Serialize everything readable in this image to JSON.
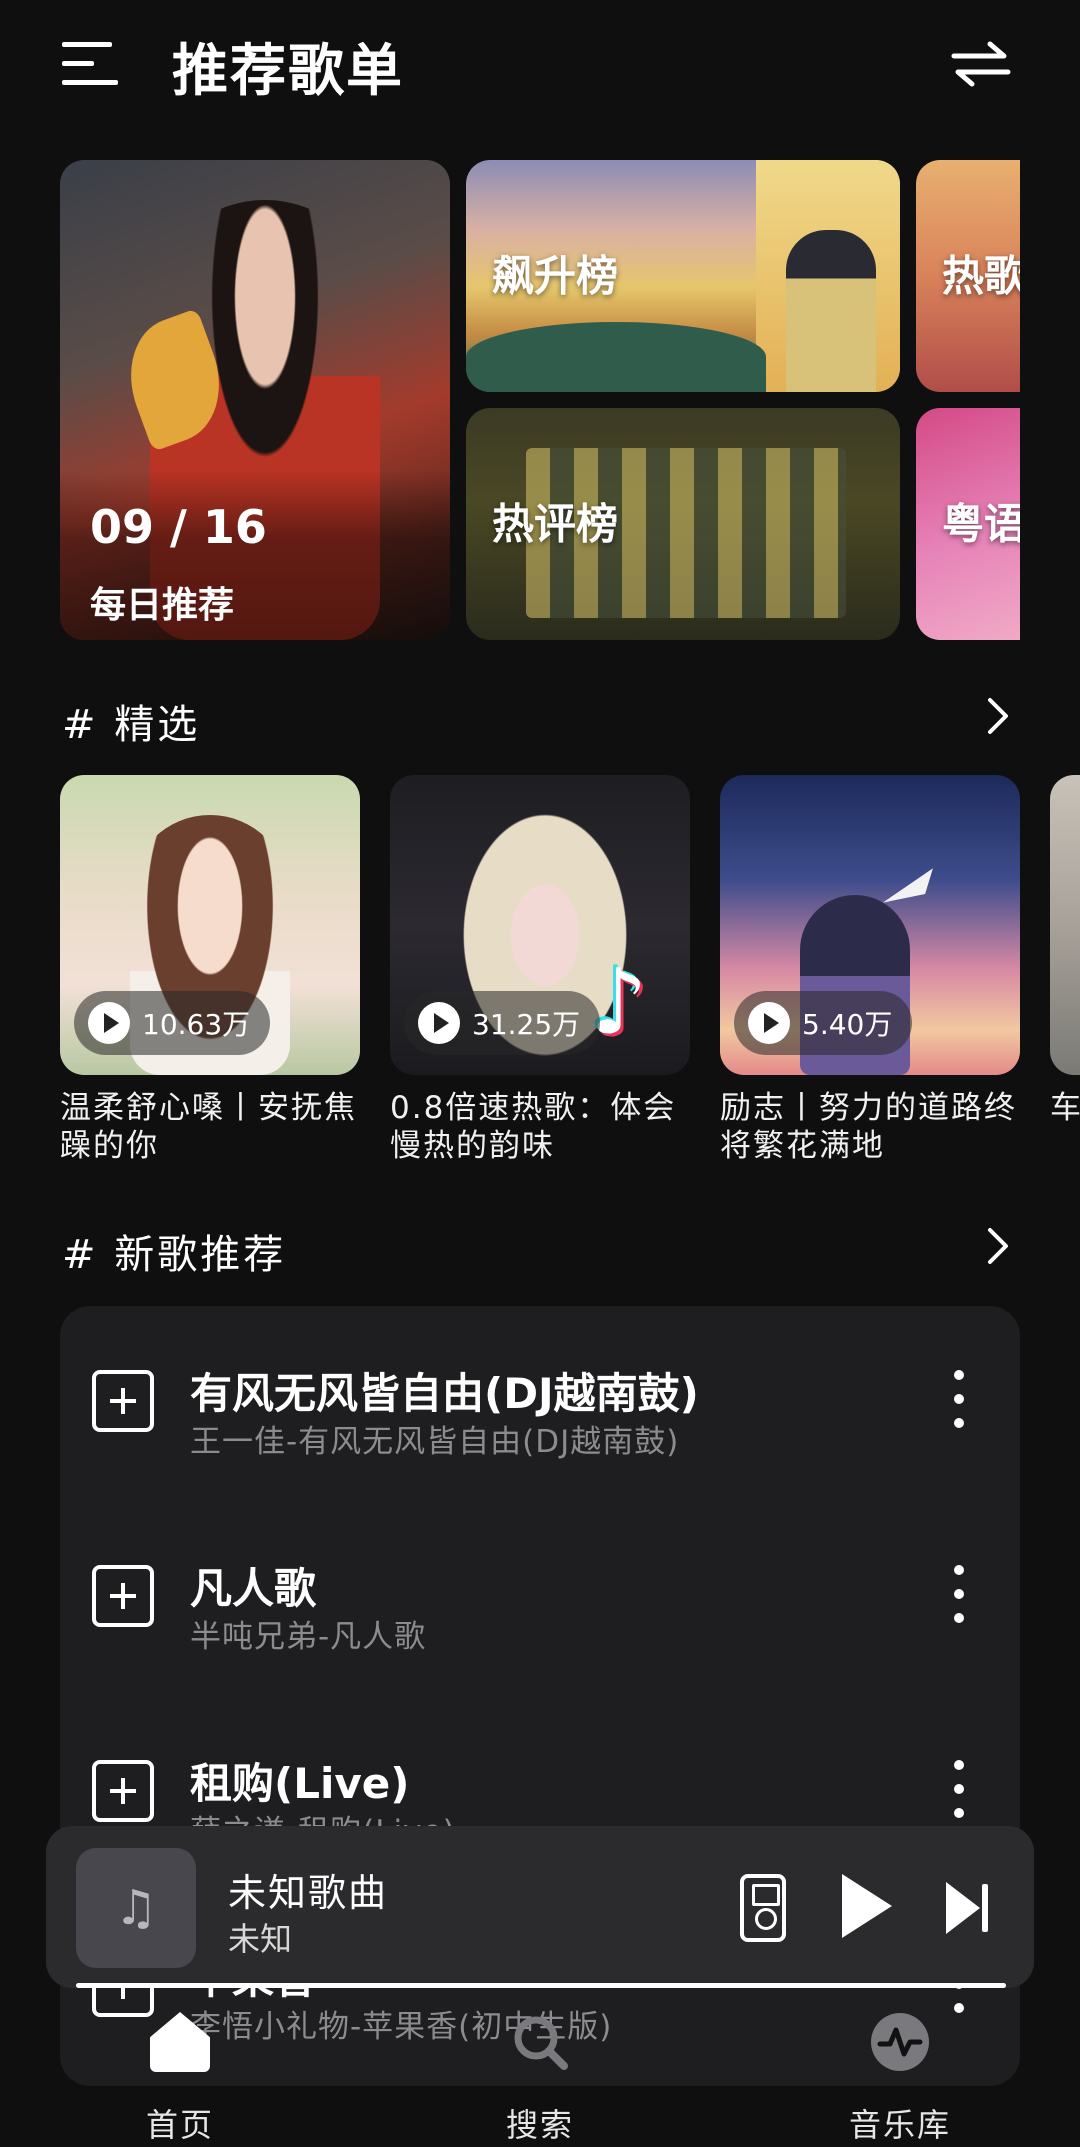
{
  "header": {
    "title": "推荐歌单"
  },
  "top_cards": {
    "daily": {
      "date": "09 / 16",
      "label": "每日推荐"
    },
    "charts": [
      "飙升榜",
      "热歌榜",
      "热评榜",
      "粤语榜"
    ]
  },
  "featured": {
    "title": "# 精选",
    "items": [
      {
        "plays": "10.63万",
        "name": "温柔舒心嗓丨安抚焦躁的你"
      },
      {
        "plays": "31.25万",
        "name": "0.8倍速热歌：体会慢热的韵味"
      },
      {
        "plays": "5.40万",
        "name": "励志丨努力的道路终将繁花满地"
      },
      {
        "plays": "",
        "name": "车底"
      }
    ]
  },
  "new_songs": {
    "title": "# 新歌推荐",
    "items": [
      {
        "title": "有风无风皆自由(DJ越南鼓)",
        "sub": "王一佳-有风无风皆自由(DJ越南鼓)"
      },
      {
        "title": "凡人歌",
        "sub": "半吨兄弟-凡人歌"
      },
      {
        "title": "租购(Live)",
        "sub": "薛之谦-租购(Live)"
      },
      {
        "title": "苹果香",
        "sub": "李悟小礼物-苹果香(初中生版)"
      }
    ]
  },
  "player": {
    "title": "未知歌曲",
    "artist": "未知",
    "progress": 1.0
  },
  "nav": [
    {
      "label": "首页",
      "icon": "home-icon"
    },
    {
      "label": "搜索",
      "icon": "search-icon"
    },
    {
      "label": "音乐库",
      "icon": "library-icon"
    }
  ]
}
